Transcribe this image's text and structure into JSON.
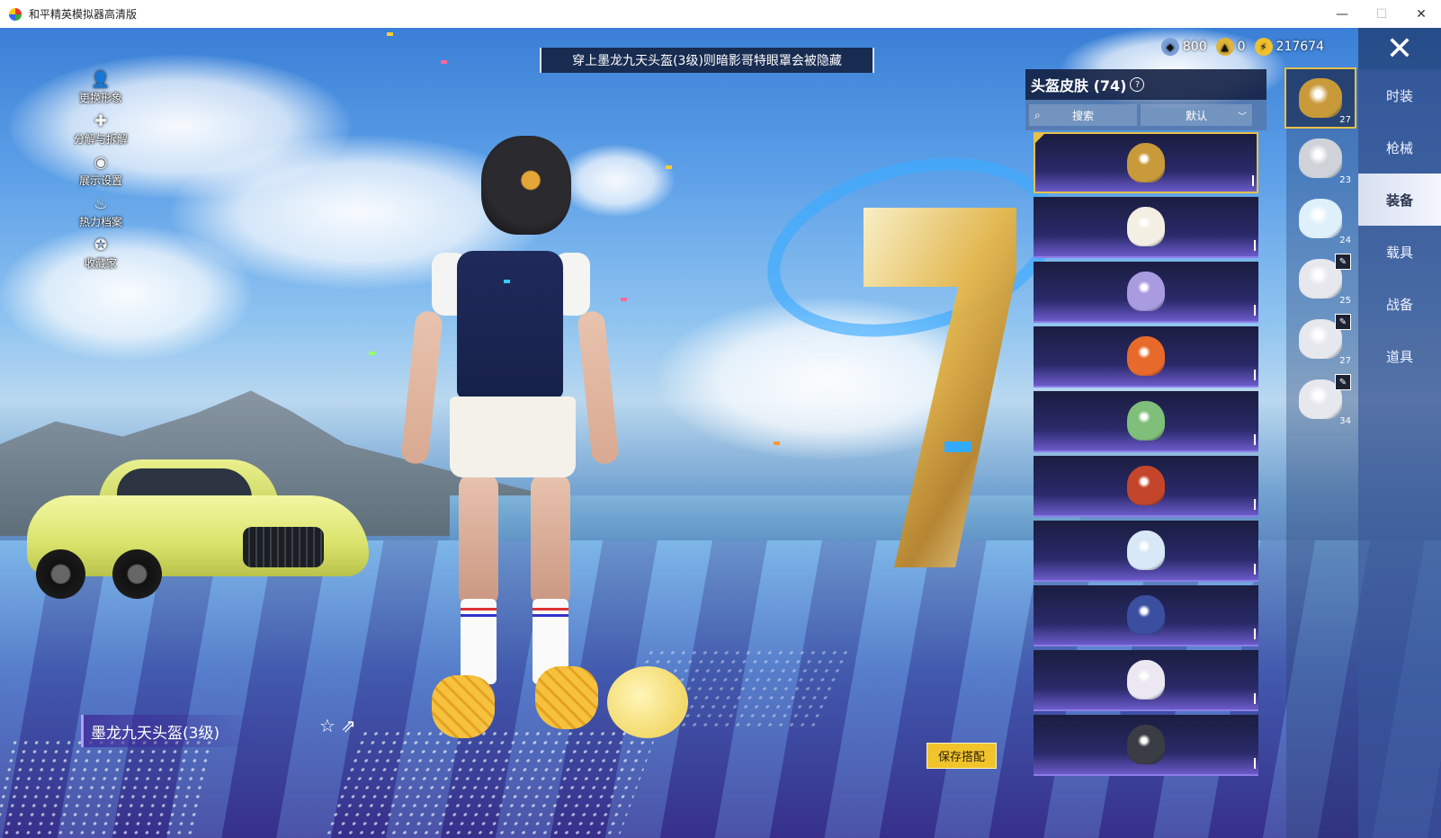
{
  "window": {
    "title": "和平精英模拟器高清版",
    "minimize": "—",
    "maximize": "☐",
    "close": "✕"
  },
  "notice": "穿上墨龙九天头盔(3级)则暗影哥特眼罩会被隐藏",
  "left_menu": [
    {
      "label": "更换形象",
      "icon": "person-icon",
      "glyph": "👤"
    },
    {
      "label": "分解与拆解",
      "icon": "puzzle-icon",
      "glyph": "✚"
    },
    {
      "label": "展示设置",
      "icon": "eye-icon",
      "glyph": "◉"
    },
    {
      "label": "热力档案",
      "icon": "flame-icon",
      "glyph": "♨"
    },
    {
      "label": "收藏家",
      "icon": "collector-badge-icon",
      "glyph": "✪"
    }
  ],
  "currency": [
    {
      "value": "800",
      "icon": "coupon-coin-icon",
      "color": "#7aa0d8"
    },
    {
      "value": "0",
      "icon": "gold-badge-coin-icon",
      "color": "#e0b43a"
    },
    {
      "value": "217674",
      "icon": "bolt-coin-icon",
      "color": "#f0c030"
    }
  ],
  "panel": {
    "title": "头盔皮肤 (74)",
    "help_glyph": "?",
    "search_label": "搜索",
    "sort_label": "默认"
  },
  "skins": [
    {
      "icon": "dragon-helmet-icon",
      "color": "#c89a3a",
      "selected": true
    },
    {
      "icon": "white-helmet-icon",
      "color": "#f3efe2",
      "selected": false
    },
    {
      "icon": "purple-cat-helmet-icon",
      "color": "#a89be0",
      "selected": false
    },
    {
      "icon": "orange-fox-helmet-icon",
      "color": "#e86a2a",
      "selected": false
    },
    {
      "icon": "green-blue-helmet-icon",
      "color": "#7fbf7a",
      "selected": false
    },
    {
      "icon": "red-beast-helmet-icon",
      "color": "#c4462a",
      "selected": false
    },
    {
      "icon": "white-blue-helmet-icon",
      "color": "#d8e8f6",
      "selected": false
    },
    {
      "icon": "blue-mech-helmet-icon",
      "color": "#3b4fa0",
      "selected": false
    },
    {
      "icon": "white-bunny-helmet-icon",
      "color": "#ece8f2",
      "selected": false
    },
    {
      "icon": "black-silver-helmet-icon",
      "color": "#3a3d44",
      "selected": false
    }
  ],
  "categories": [
    {
      "count": "27",
      "icon": "dragon-helmet-thumb-icon",
      "color": "#c89a3a",
      "selected": true,
      "locked": false
    },
    {
      "count": "23",
      "icon": "armor-vest-thumb-icon",
      "color": "#cfd2d8",
      "selected": false,
      "locked": false
    },
    {
      "count": "24",
      "icon": "backpack-thumb-icon",
      "color": "#dff0fb",
      "selected": false,
      "locked": false
    },
    {
      "count": "25",
      "icon": "bunny-pendant-thumb-icon",
      "color": "#e7e7ee",
      "selected": false,
      "locked": true
    },
    {
      "count": "27",
      "icon": "bunny-pendant-thumb-icon",
      "color": "#e7e7ee",
      "selected": false,
      "locked": true
    },
    {
      "count": "34",
      "icon": "bunny-pendant-thumb-icon",
      "color": "#e7e7ee",
      "selected": false,
      "locked": true
    }
  ],
  "tabs": [
    {
      "label": "时装",
      "active": false
    },
    {
      "label": "枪械",
      "active": false
    },
    {
      "label": "装备",
      "active": true
    },
    {
      "label": "载具",
      "active": false
    },
    {
      "label": "战备",
      "active": false
    },
    {
      "label": "道具",
      "active": false
    }
  ],
  "selected_skin_name": "墨龙九天头盔(3级)",
  "save_button": "保存搭配",
  "close_glyph": "✕"
}
